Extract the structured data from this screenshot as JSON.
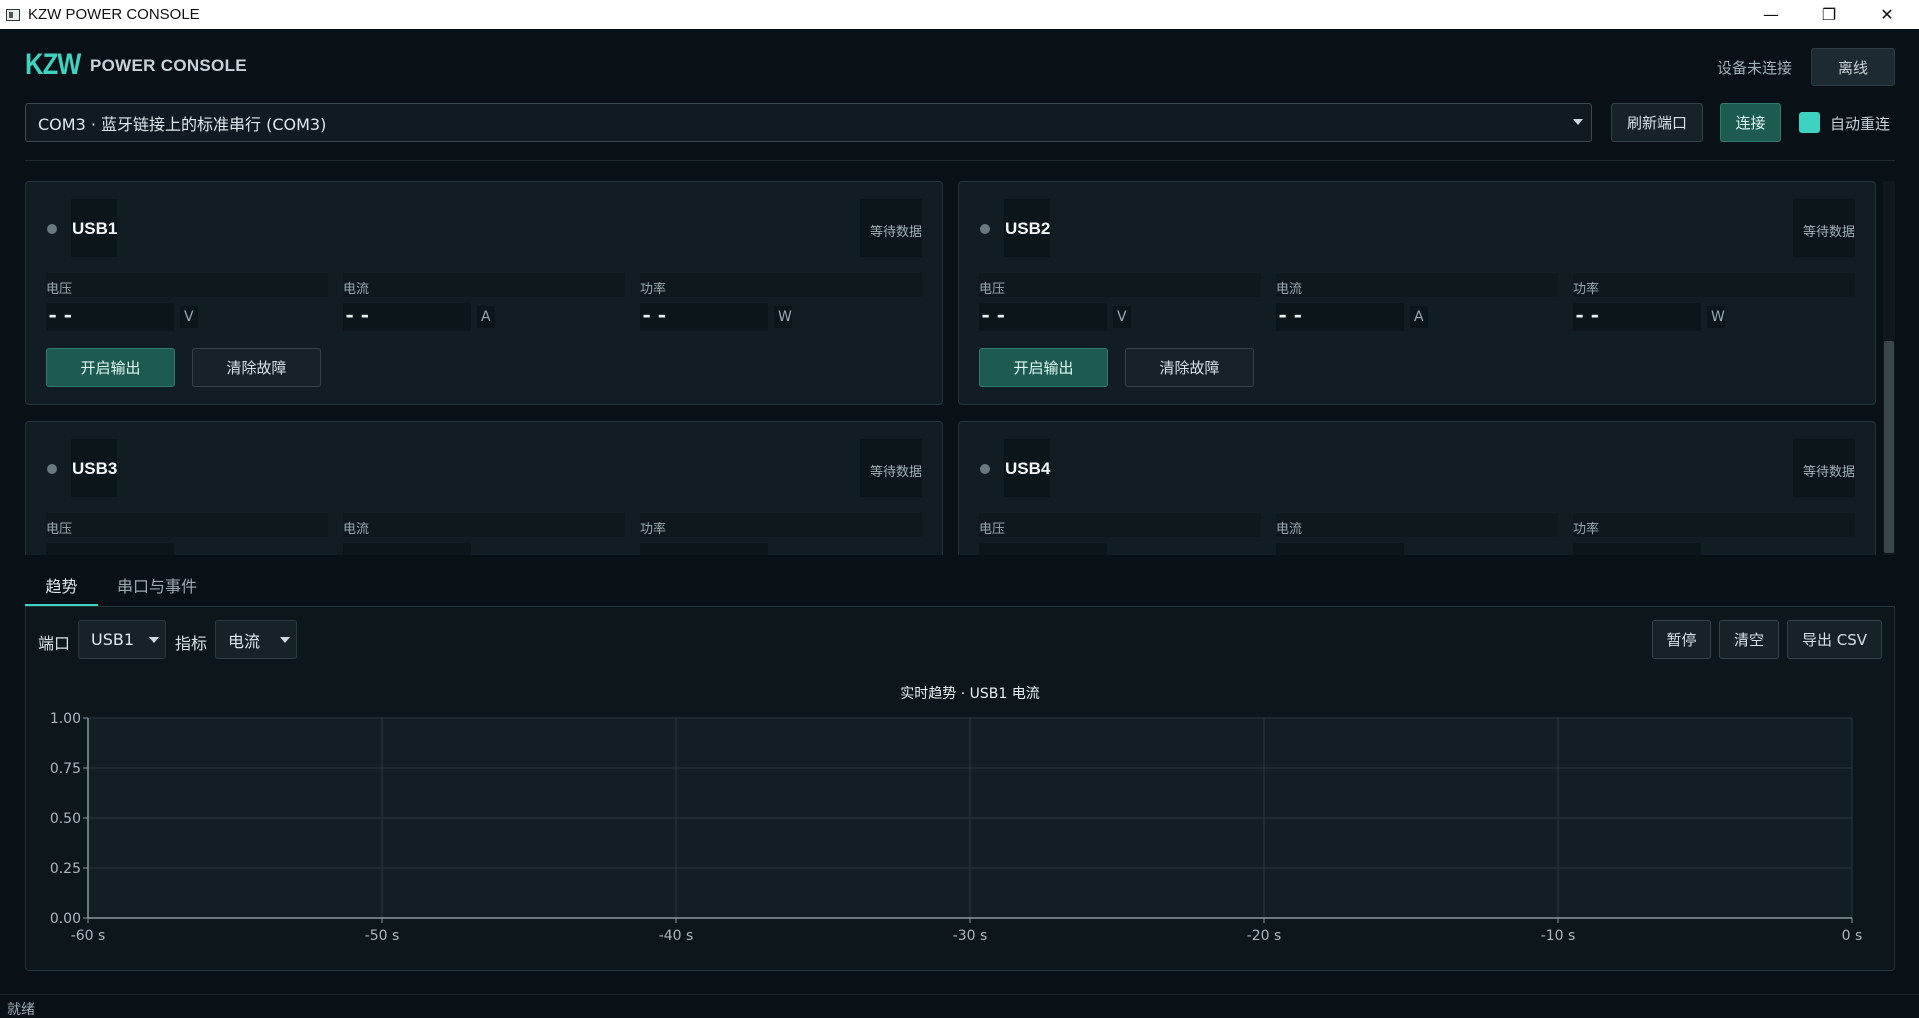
{
  "window": {
    "title": "KZW POWER CONSOLE",
    "controls": {
      "minimize": "—",
      "restore": "❐",
      "close": "✕"
    }
  },
  "header": {
    "logo": "KZW",
    "title": "POWER CONSOLE",
    "connection_status": "设备未连接",
    "offline_label": "离线"
  },
  "port_bar": {
    "selected_port": "COM3 · 蓝牙链接上的标准串行 (COM3)",
    "refresh_label": "刷新端口",
    "connect_label": "连接",
    "auto_reconnect_label": "自动重连",
    "auto_reconnect_checked": true
  },
  "cards": [
    {
      "name": "USB1",
      "status": "等待数据",
      "voltage_label": "电压",
      "voltage": "--",
      "voltage_unit": "V",
      "current_label": "电流",
      "current": "--",
      "current_unit": "A",
      "power_label": "功率",
      "power": "--",
      "power_unit": "W",
      "enable_label": "开启输出",
      "clear_label": "清除故障"
    },
    {
      "name": "USB2",
      "status": "等待数据",
      "voltage_label": "电压",
      "voltage": "--",
      "voltage_unit": "V",
      "current_label": "电流",
      "current": "--",
      "current_unit": "A",
      "power_label": "功率",
      "power": "--",
      "power_unit": "W",
      "enable_label": "开启输出",
      "clear_label": "清除故障"
    },
    {
      "name": "USB3",
      "status": "等待数据",
      "voltage_label": "电压",
      "current_label": "电流",
      "power_label": "功率"
    },
    {
      "name": "USB4",
      "status": "等待数据",
      "voltage_label": "电压",
      "current_label": "电流",
      "power_label": "功率"
    }
  ],
  "tabs": [
    {
      "label": "趋势",
      "active": true
    },
    {
      "label": "串口与事件",
      "active": false
    }
  ],
  "trend": {
    "port_label": "端口",
    "port_value": "USB1",
    "metric_label": "指标",
    "metric_value": "电流",
    "pause_label": "暂停",
    "clear_label": "清空",
    "export_label": "导出 CSV"
  },
  "chart_data": {
    "type": "line",
    "title": "实时趋势 · USB1 电流",
    "xlabel": "",
    "ylabel": "",
    "x_ticks": [
      "-60 s",
      "-50 s",
      "-40 s",
      "-30 s",
      "-20 s",
      "-10 s",
      "0 s"
    ],
    "y_ticks": [
      "0.00",
      "0.25",
      "0.50",
      "0.75",
      "1.00"
    ],
    "xlim": [
      -60,
      0
    ],
    "ylim": [
      0,
      1
    ],
    "grid": true,
    "series": []
  },
  "colors": {
    "accent": "#3ed3c0",
    "accent_button": "#1d5a50",
    "background": "#0a1116",
    "card": "#121d23"
  },
  "status_bar": {
    "text": "就绪"
  }
}
